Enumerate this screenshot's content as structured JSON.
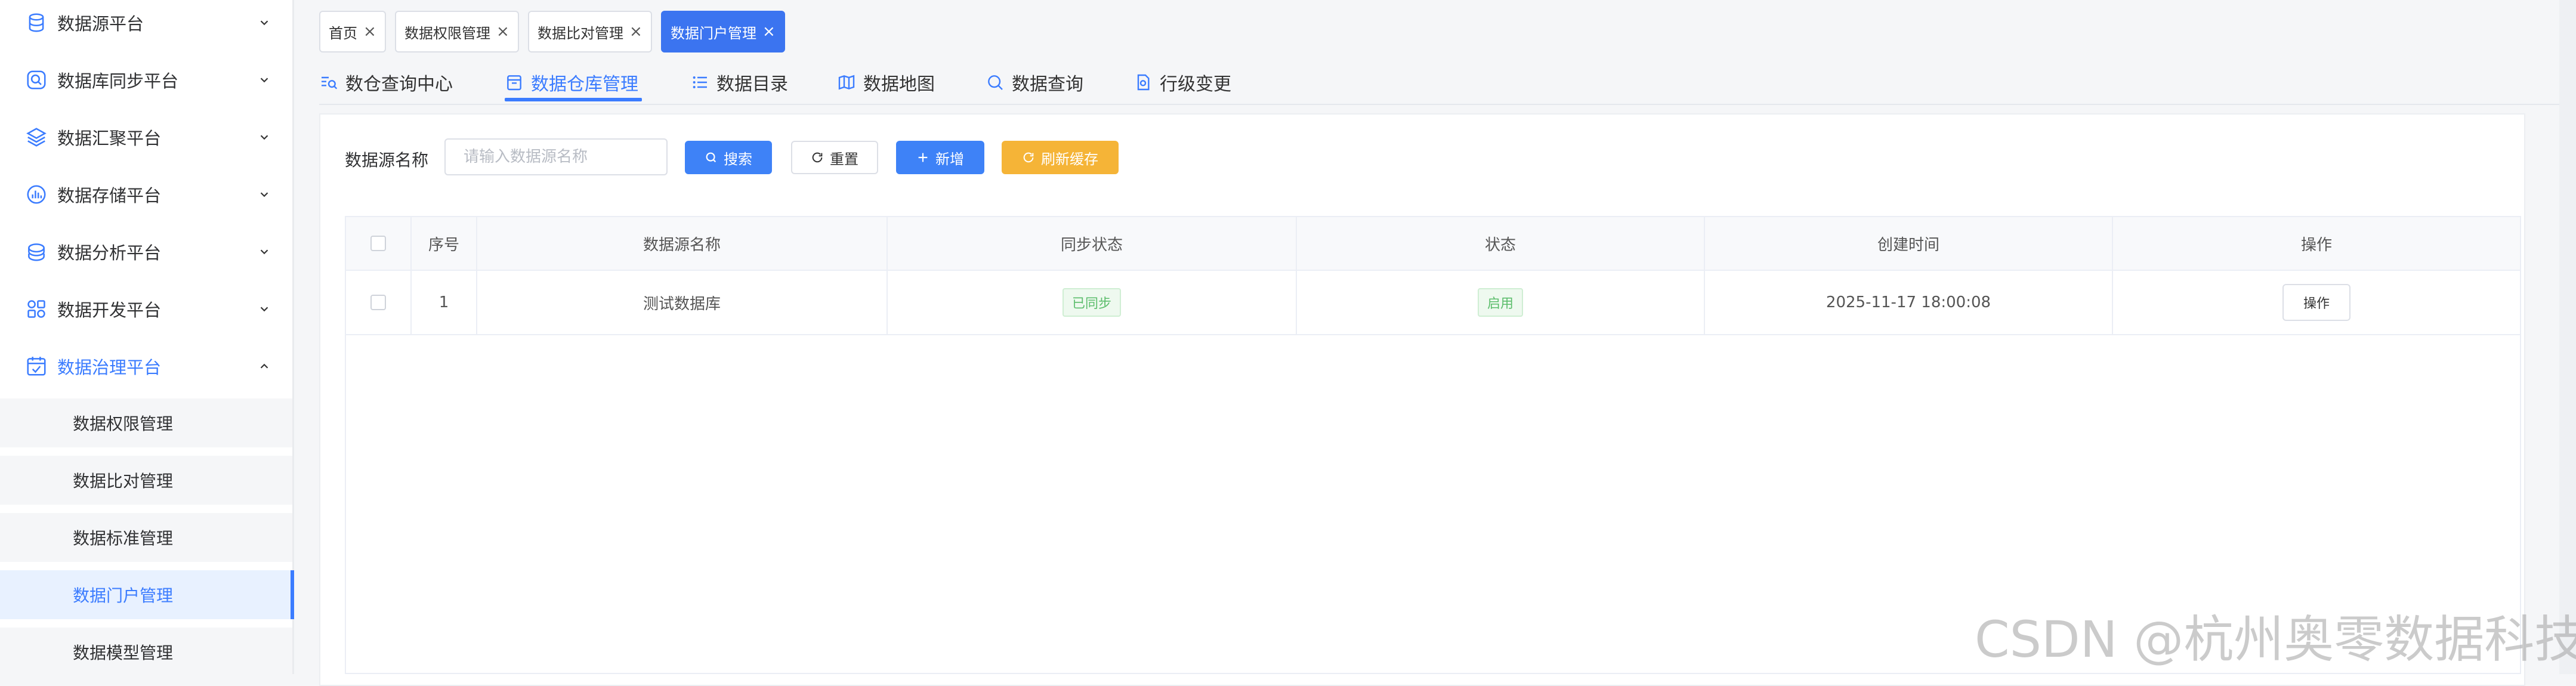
{
  "sidebar": {
    "items": [
      {
        "label": "数据源平台",
        "icon": "database-icon",
        "expanded": false
      },
      {
        "label": "数据库同步平台",
        "icon": "sync-search-icon",
        "expanded": false
      },
      {
        "label": "数据汇聚平台",
        "icon": "layers-icon",
        "expanded": false
      },
      {
        "label": "数据存储平台",
        "icon": "storage-chart-icon",
        "expanded": false
      },
      {
        "label": "数据分析平台",
        "icon": "analysis-icon",
        "expanded": false
      },
      {
        "label": "数据开发平台",
        "icon": "grid-apps-icon",
        "expanded": false
      },
      {
        "label": "数据治理平台",
        "icon": "governance-calendar-icon",
        "expanded": true
      }
    ],
    "sub_items": [
      {
        "label": "数据权限管理",
        "selected": false
      },
      {
        "label": "数据比对管理",
        "selected": false
      },
      {
        "label": "数据标准管理",
        "selected": false
      },
      {
        "label": "数据门户管理",
        "selected": true
      },
      {
        "label": "数据模型管理",
        "selected": false
      }
    ]
  },
  "tags": [
    {
      "label": "首页",
      "active": false
    },
    {
      "label": "数据权限管理",
      "active": false
    },
    {
      "label": "数据比对管理",
      "active": false
    },
    {
      "label": "数据门户管理",
      "active": true
    }
  ],
  "subnav": [
    {
      "label": "数仓查询中心",
      "icon": "query-list-icon",
      "active": false
    },
    {
      "label": "数据仓库管理",
      "icon": "warehouse-box-icon",
      "active": true
    },
    {
      "label": "数据目录",
      "icon": "catalog-list-icon",
      "active": false
    },
    {
      "label": "数据地图",
      "icon": "map-icon",
      "active": false
    },
    {
      "label": "数据查询",
      "icon": "search-icon",
      "active": false
    },
    {
      "label": "行级变更",
      "icon": "document-change-icon",
      "active": false
    }
  ],
  "filter": {
    "label": "数据源名称",
    "placeholder": "请输入数据源名称",
    "value": ""
  },
  "buttons": {
    "search": "搜索",
    "reset": "重置",
    "add": "新增",
    "refresh_cache": "刷新缓存"
  },
  "table": {
    "columns": [
      "",
      "序号",
      "数据源名称",
      "同步状态",
      "状态",
      "创建时间",
      "操作"
    ],
    "rows": [
      {
        "index": "1",
        "name": "测试数据库",
        "sync_status": "已同步",
        "status": "启用",
        "created": "2025-11-17 18:00:08",
        "action": "操作"
      }
    ]
  },
  "colors": {
    "accent": "#3b7cff",
    "warning": "#f5b437",
    "success": "#5bbd6b"
  },
  "watermark": "CSDN @杭州奥零数据科技"
}
